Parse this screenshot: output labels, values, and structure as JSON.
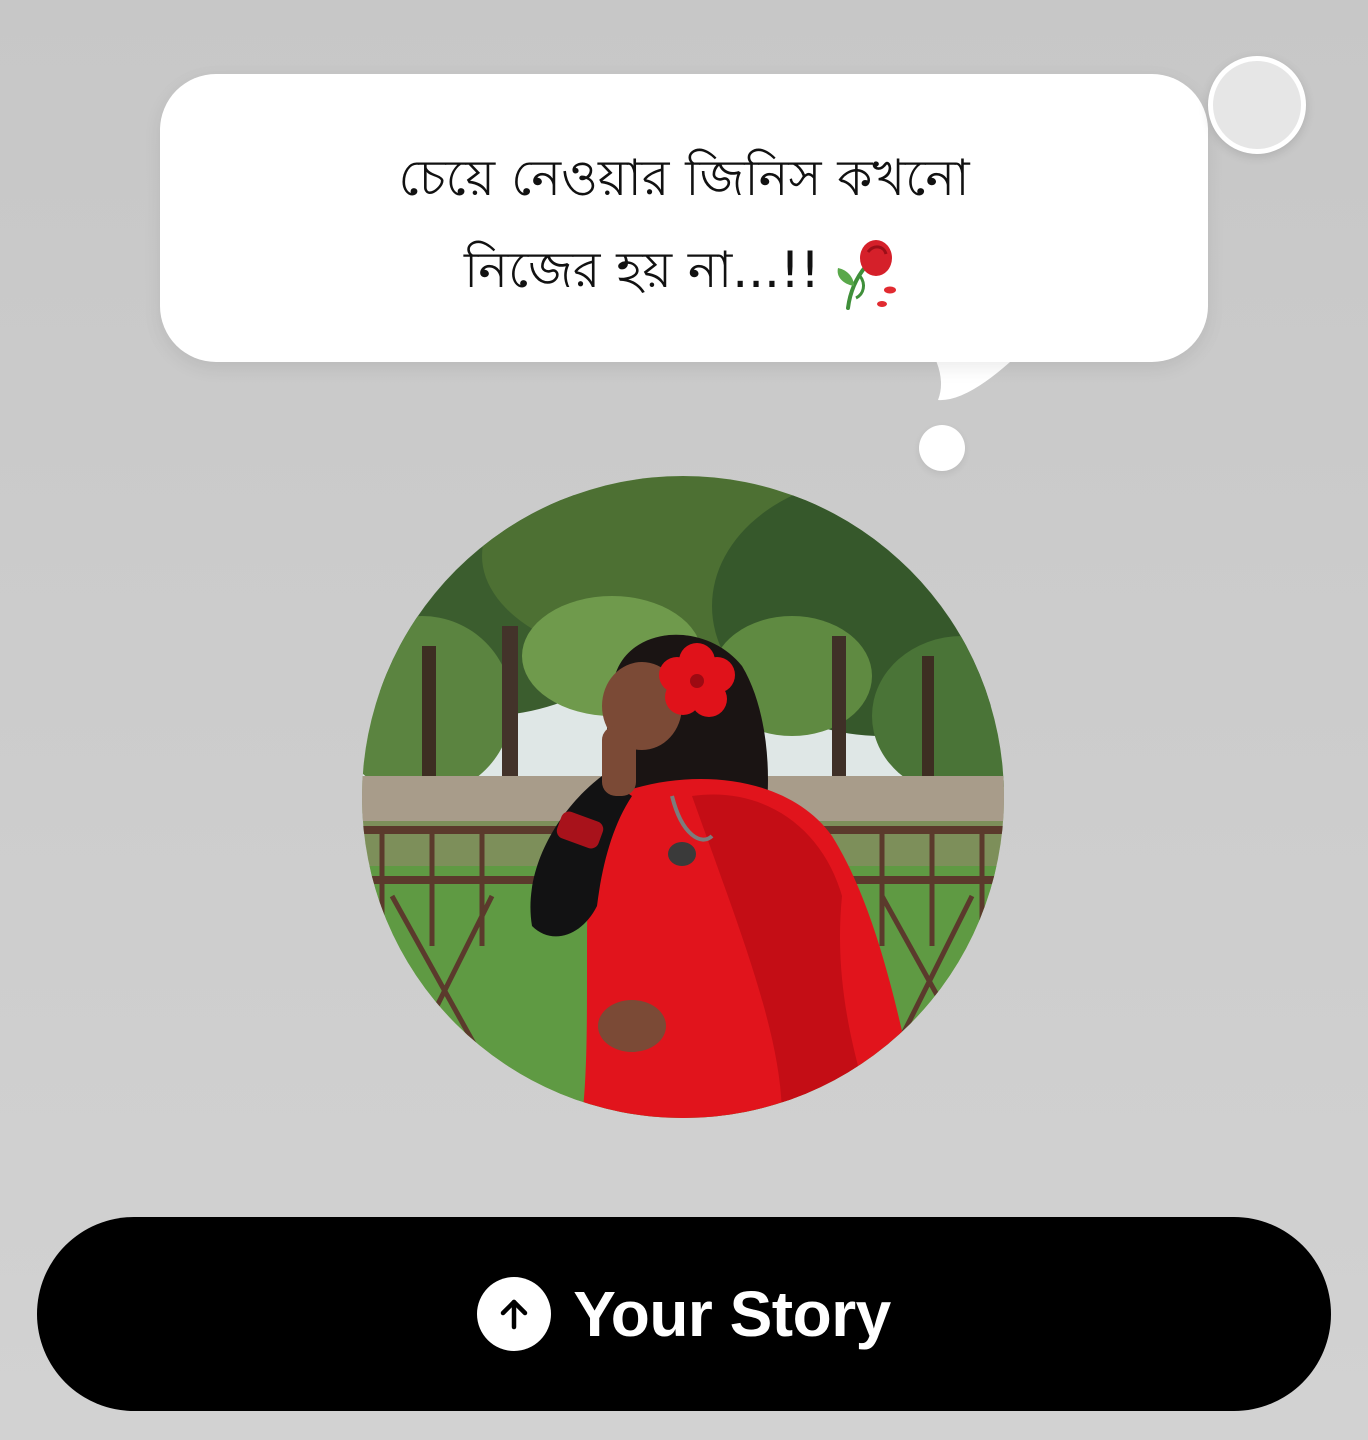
{
  "note": {
    "line1": "চেয়ে নেওয়ার জিনিস কখনো",
    "line2": "নিজের হয় না...!!",
    "emoji_icon": "wilted-rose-icon"
  },
  "profile": {
    "avatar_icon": "profile-photo"
  },
  "story_button": {
    "label": "Your Story",
    "icon": "arrow-up-circle-icon"
  },
  "colors": {
    "background": "#cbcbcb",
    "bubble": "#ffffff",
    "button": "#000000",
    "button_text": "#ffffff"
  }
}
